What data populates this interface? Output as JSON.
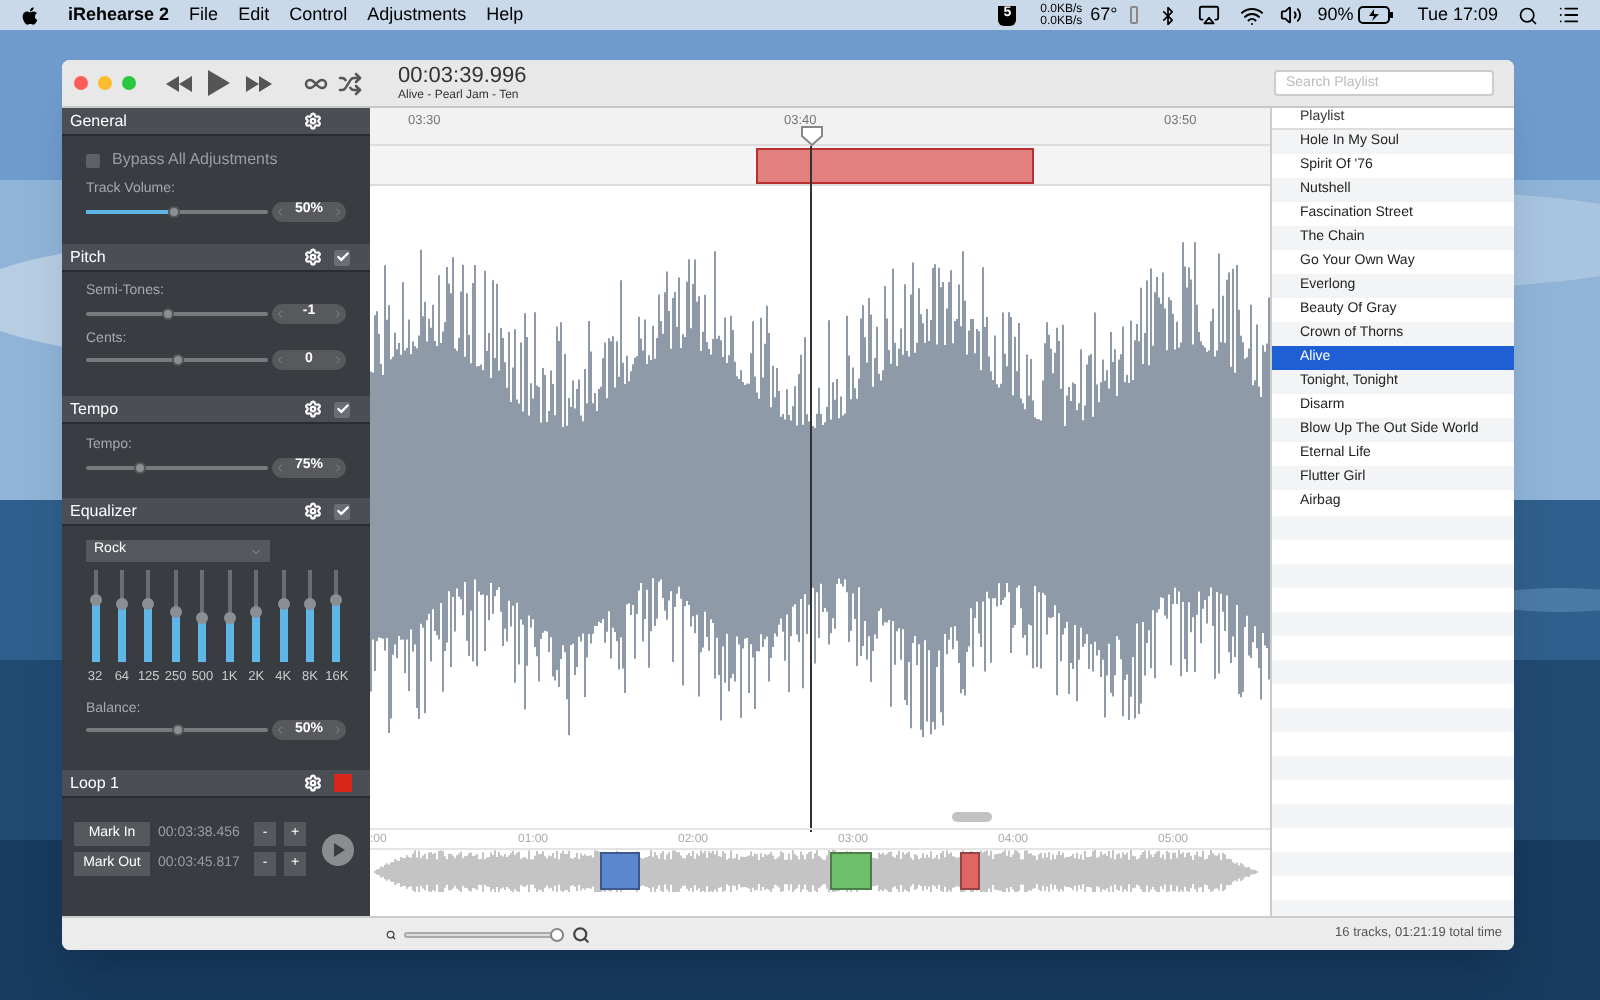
{
  "menubar": {
    "app": "iRehearse 2",
    "menus": [
      "File",
      "Edit",
      "Control",
      "Adjustments",
      "Help"
    ],
    "badge": "5",
    "net_up": "0.0KB/s",
    "net_down": "0.0KB/s",
    "temperature": "67°",
    "battery": "90%",
    "clock": "Tue 17:09"
  },
  "toolbar": {
    "time": "00:03:39.996",
    "track": "Alive - Pearl Jam - Ten",
    "search": {
      "placeholder": "Search Playlist"
    }
  },
  "general": {
    "title": "General",
    "bypass": {
      "label": "Bypass All Adjustments",
      "checked": false
    },
    "volume": {
      "label": "Track Volume:",
      "level": 0.48,
      "reading": "50%"
    }
  },
  "pitch": {
    "title": "Pitch",
    "enabled": true,
    "sliders": [
      {
        "label": "Semi-Tones:",
        "level": 0.45,
        "reading": "-1"
      },
      {
        "label": "Cents:",
        "level": 0.5,
        "reading": "0"
      }
    ]
  },
  "tempo": {
    "title": "Tempo",
    "enabled": true,
    "sliders": [
      {
        "label": "Tempo:",
        "level": 0.3,
        "reading": "75%"
      }
    ]
  },
  "equalizer": {
    "title": "Equalizer",
    "enabled": true,
    "preset": "Rock",
    "bands": [
      {
        "label": "32",
        "level": 0.68
      },
      {
        "label": "64",
        "level": 0.64
      },
      {
        "label": "125",
        "level": 0.62
      },
      {
        "label": "250",
        "level": 0.55
      },
      {
        "label": "500",
        "level": 0.48
      },
      {
        "label": "1K",
        "level": 0.48
      },
      {
        "label": "2K",
        "level": 0.55
      },
      {
        "label": "4K",
        "level": 0.62
      },
      {
        "label": "8K",
        "level": 0.64
      },
      {
        "label": "16K",
        "level": 0.68
      }
    ],
    "balance": {
      "label": "Balance:",
      "level": 0.5,
      "reading": "50%"
    }
  },
  "loop": {
    "title": "Loop 1",
    "color": "#d9261c",
    "mark_in": {
      "button": "Mark In",
      "time": "00:03:38.456"
    },
    "mark_out": {
      "button": "Mark Out",
      "time": "00:03:45.817"
    },
    "minus": "-",
    "plus": "+"
  },
  "timeline": {
    "ticks": [
      "03:30",
      "03:40",
      "03:50"
    ]
  },
  "overview": {
    "ticks": [
      ":00",
      "01:00",
      "02:00",
      "03:00",
      "04:00",
      "05:00"
    ],
    "loops": [
      {
        "color": "#5b86d0"
      },
      {
        "color": "#6fbf6a"
      },
      {
        "color": "#e06666"
      }
    ],
    "zoom": {
      "level": 1
    }
  },
  "playlist": {
    "header": "Playlist",
    "items": [
      {
        "title": "Hole In My Soul",
        "selected": false
      },
      {
        "title": "Spirit Of '76",
        "selected": false
      },
      {
        "title": "Nutshell",
        "selected": false
      },
      {
        "title": "Fascination Street",
        "selected": false
      },
      {
        "title": "The Chain",
        "selected": false
      },
      {
        "title": "Go Your Own Way",
        "selected": false
      },
      {
        "title": "Everlong",
        "selected": false
      },
      {
        "title": "Beauty Of Gray",
        "selected": false
      },
      {
        "title": "Crown of Thorns",
        "selected": false
      },
      {
        "title": "Alive",
        "selected": true
      },
      {
        "title": "Tonight, Tonight",
        "selected": false
      },
      {
        "title": "Disarm",
        "selected": false
      },
      {
        "title": "Blow Up The Out Side World",
        "selected": false
      },
      {
        "title": "Eternal Life",
        "selected": false
      },
      {
        "title": "Flutter Girl",
        "selected": false
      },
      {
        "title": "Airbag",
        "selected": false
      }
    ],
    "status": "16 tracks, 01:21:19 total time"
  }
}
